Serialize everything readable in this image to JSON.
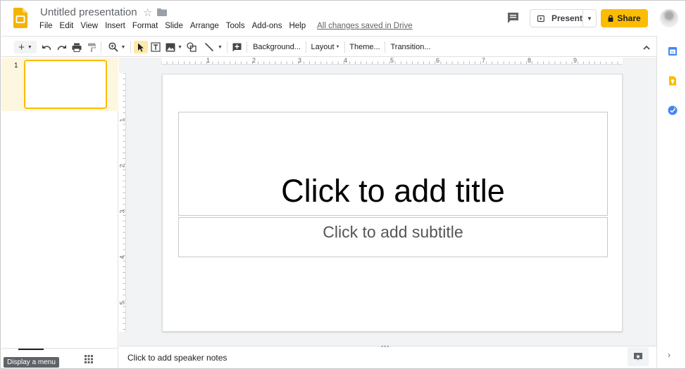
{
  "header": {
    "doc_title": "Untitled presentation",
    "menu": [
      "File",
      "Edit",
      "View",
      "Insert",
      "Format",
      "Slide",
      "Arrange",
      "Tools",
      "Add-ons",
      "Help"
    ],
    "saved_status": "All changes saved in Drive",
    "present_label": "Present",
    "share_label": "Share",
    "accent_color": "#fbbc04"
  },
  "toolbar": {
    "background_label": "Background...",
    "layout_label": "Layout",
    "theme_label": "Theme...",
    "transition_label": "Transition..."
  },
  "filmstrip": {
    "slide_number": "1",
    "tooltip": "Display a menu"
  },
  "ruler": {
    "horizontal": [
      "1",
      "2",
      "3",
      "4",
      "5",
      "6",
      "7",
      "8",
      "9"
    ],
    "vertical": [
      "1",
      "2",
      "3",
      "4",
      "5"
    ]
  },
  "slide": {
    "title_placeholder": "Click to add title",
    "subtitle_placeholder": "Click to add subtitle"
  },
  "notes": {
    "placeholder": "Click to add speaker notes"
  }
}
